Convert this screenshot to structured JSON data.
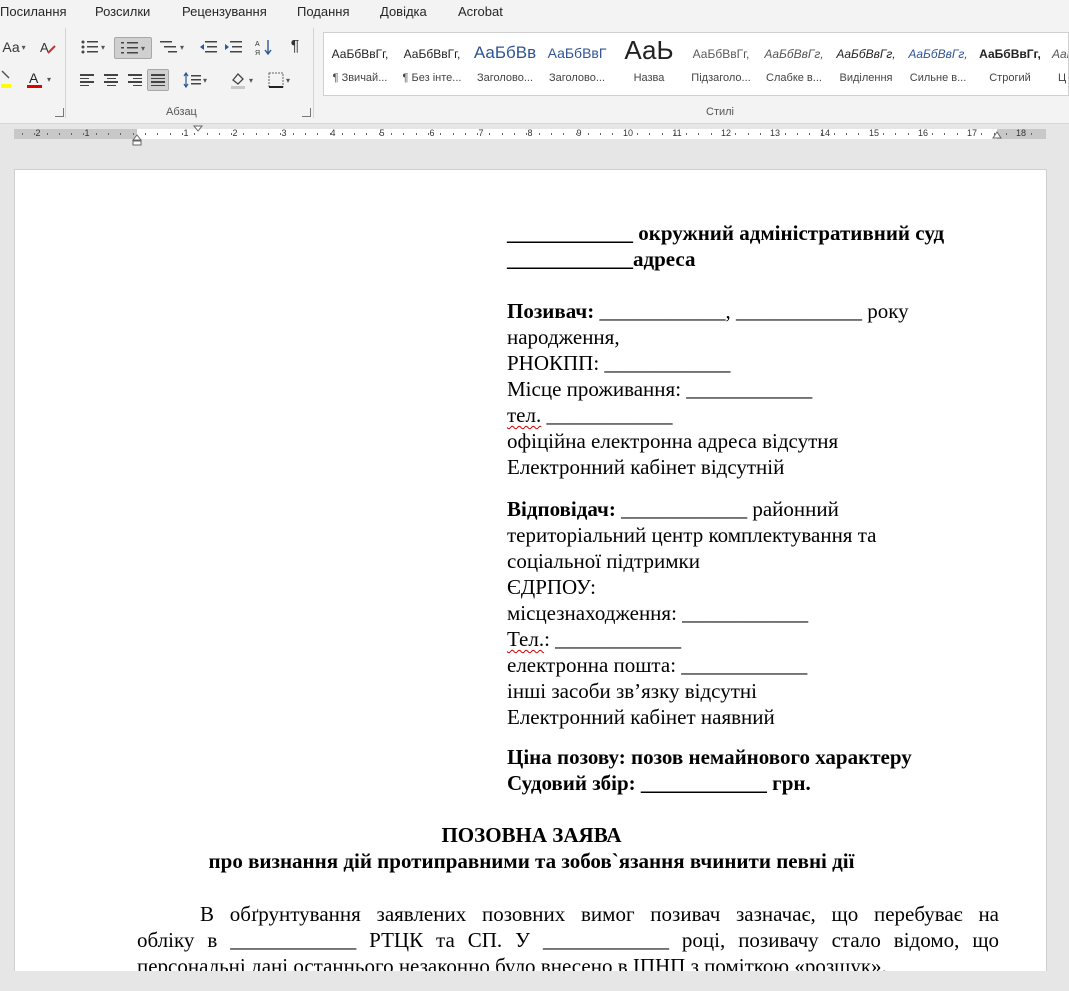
{
  "menu": [
    "Посилання",
    "Розсилки",
    "Рецензування",
    "Подання",
    "Довідка",
    "Acrobat"
  ],
  "ribbon": {
    "font_group": {
      "case_label": "Аа",
      "color_label": "А"
    },
    "paragraph_label": "Абзац",
    "styles_label": "Стилі",
    "styles": [
      {
        "preview": "АаБбВвГг,",
        "name": "¶ Звичай..."
      },
      {
        "preview": "АаБбВвГг,",
        "name": "¶ Без інте..."
      },
      {
        "preview": "АаБбВв",
        "name": "Заголово..."
      },
      {
        "preview": "АаБбВвГ",
        "name": "Заголово..."
      },
      {
        "preview": "АаЬ",
        "name": "Назва"
      },
      {
        "preview": "АаБбВвГг,",
        "name": "Підзаголо..."
      },
      {
        "preview": "АаБбВвГг,",
        "name": "Слабке в..."
      },
      {
        "preview": "АаБбВвГг,",
        "name": "Виділення"
      },
      {
        "preview": "АаБбВвГг,",
        "name": "Сильне в..."
      },
      {
        "preview": "АаБбВвГг,",
        "name": "Строгий"
      },
      {
        "preview": "АаБ",
        "name": "Ц"
      }
    ],
    "accent_colors": {
      "highlight": "#ffff00",
      "font_color": "#e00000"
    }
  },
  "ruler": {
    "labels": [
      "2",
      "1",
      "1",
      "2",
      "3",
      "4",
      "5",
      "6",
      "7",
      "8",
      "9",
      "10",
      "11",
      "12",
      "13",
      "14",
      "15",
      "16",
      "17",
      "18"
    ]
  },
  "document": {
    "court_line": {
      "blank": "____________",
      "text": " окружний адміністративний суд"
    },
    "address_line": {
      "blank": "____________",
      "text": "адреса"
    },
    "plaintiff": {
      "label": "Позивач:",
      "line1_rest": " ____________, ____________ року",
      "line2": "народження,",
      "line3": "РНОКПП: ____________",
      "line4": "Місце проживання: ____________",
      "line5_a": "тел.",
      "line5_b": " ____________",
      "line6": "офіційна електронна адреса відсутня",
      "line7": "Електронний кабінет відсутній"
    },
    "defendant": {
      "label": "Відповідач:",
      "line1_rest": " ____________ районний",
      "line2": "територіальний центр комплектування та",
      "line3": "соціальної підтримки",
      "line4": "ЄДРПОУ:",
      "line5": "місцезнаходження: ____________",
      "line6_a": "Тел.",
      "line6_b": ": ____________",
      "line7": "електронна пошта: ____________",
      "line8": "інші засоби зв’язку відсутні",
      "line9": "Електронний кабінет наявний"
    },
    "claim_price": "Ціна позову: позов немайнового характеру",
    "court_fee": "Судовий збір: ____________ грн.",
    "title": "ПОЗОВНА ЗАЯВА",
    "subtitle": "про визнання дій протиправними та зобов`язання вчинити певні дії",
    "body_lines": [
      "В обґрунтування заявлених позовних вимог позивач зазначає, що перебуває на",
      "обліку в ____________ РТЦК та СП. У ____________ році, позивачу стало відомо, що",
      "персональні дані останнього незаконно було внесено в ІПНП з поміткою «розшук»."
    ]
  }
}
